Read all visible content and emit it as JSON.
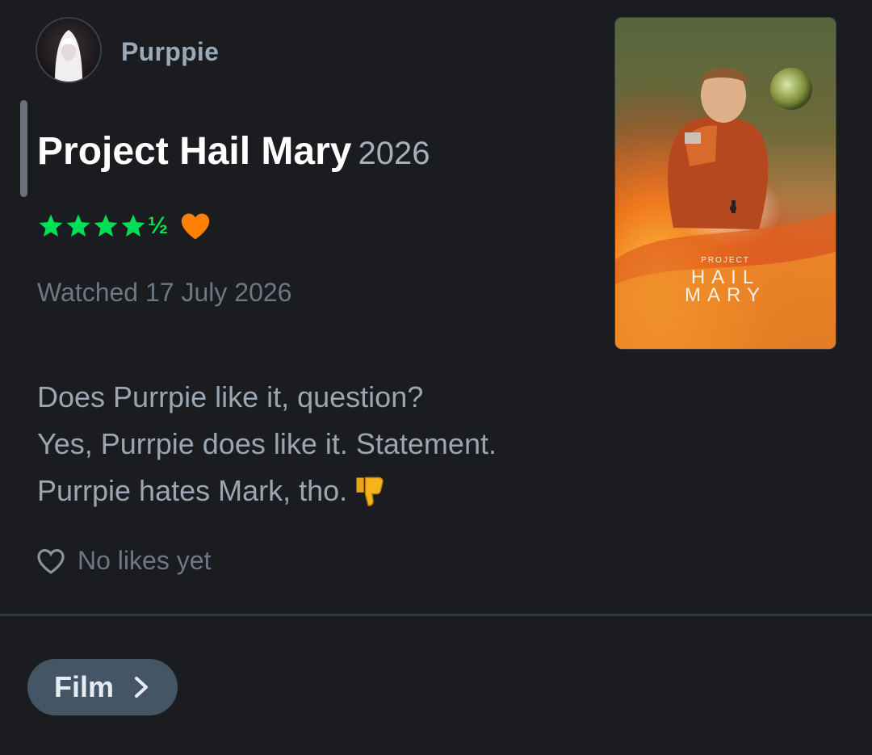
{
  "user": {
    "name": "Purppie",
    "avatar_icon": "user-avatar"
  },
  "film": {
    "title": "Project Hail Mary",
    "year": "2026",
    "rating": 4.5,
    "rating_max": 5,
    "half_star_glyph": "½",
    "liked": true,
    "poster": {
      "label_top": "PROJECT",
      "label_line1": "HAIL",
      "label_line2": "MARY"
    }
  },
  "watched": "Watched 17 July 2026",
  "review": {
    "lines": [
      "Does Purrpie like it, question?",
      "Yes, Purrpie does like it. Statement.",
      "Purrpie hates Mark, tho."
    ],
    "emoji": "thumbs-down-icon"
  },
  "likes": {
    "text": "No likes yet",
    "icon": "heart-outline-icon"
  },
  "nav": {
    "film_button_label": "Film",
    "chevron_icon": "chevron-right-icon"
  },
  "colors": {
    "background": "#1a1c20",
    "star_green": "#00e054",
    "heart_orange": "#ff8000",
    "muted_text": "#6e7784",
    "button_bg": "#445566"
  }
}
